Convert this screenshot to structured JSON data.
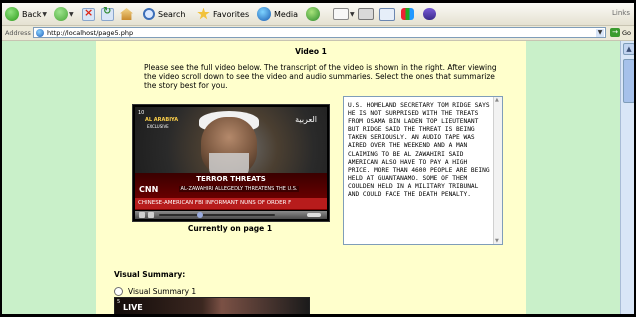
{
  "toolbar": {
    "back_label": "Back",
    "search_label": "Search",
    "favorites_label": "Favorites",
    "media_label": "Media",
    "links_label": "Links"
  },
  "address": {
    "label": "Address",
    "url": "http://localhost/page5.php",
    "go_label": "Go"
  },
  "page": {
    "title": "Video 1",
    "instructions": "Please see the full video below. The transcript of the video is shown in the right. After viewing the video scroll down to see the video and audio summaries. Select the ones that summarize the story best for you.",
    "video": {
      "overlay_left": "AL ARABIYA",
      "overlay_left_sub": "EXCLUSIVE",
      "overlay_right": "العربية",
      "badge": "10",
      "lower_title": "TERROR THREATS",
      "channel": "CNN",
      "lower_subtitle": "AL-ZAWAHIRI ALLEGEDLY THREATENS THE U.S.",
      "ticker": "CHINESE-AMERICAN FBI INFORMANT  NUNS OF ORDER F"
    },
    "current_page": "Currently on page 1",
    "transcript": "U.S. HOMELAND SECRETARY TOM RIDGE SAYS HE IS NOT SURPRISED WITH THE TREATS FROM OSAMA BIN LADEN TOP LIEUTENANT BUT RIDGE SAID THE THREAT IS BEING TAKEN SERIOUSLY. AN AUDIO TAPE WAS AIRED OVER THE WEEKEND AND A MAN CLAIMING TO BE AL ZAWAHIRI SAID AMERICAN ALSO HAVE TO PAY A HIGH PRICE. MORE THAN 4600 PEOPLE ARE BEING HELD AT GUANTANAMO. SOME OF THEM COULDEN HELD IN A MILITARY TRIBUNAL AND COULD FACE THE DEATH PENALTY.",
    "visual_summary_title": "Visual Summary:",
    "visual_summary_option": "Visual Summary 1",
    "thumb_number": "5",
    "thumb_live": "LIVE"
  }
}
